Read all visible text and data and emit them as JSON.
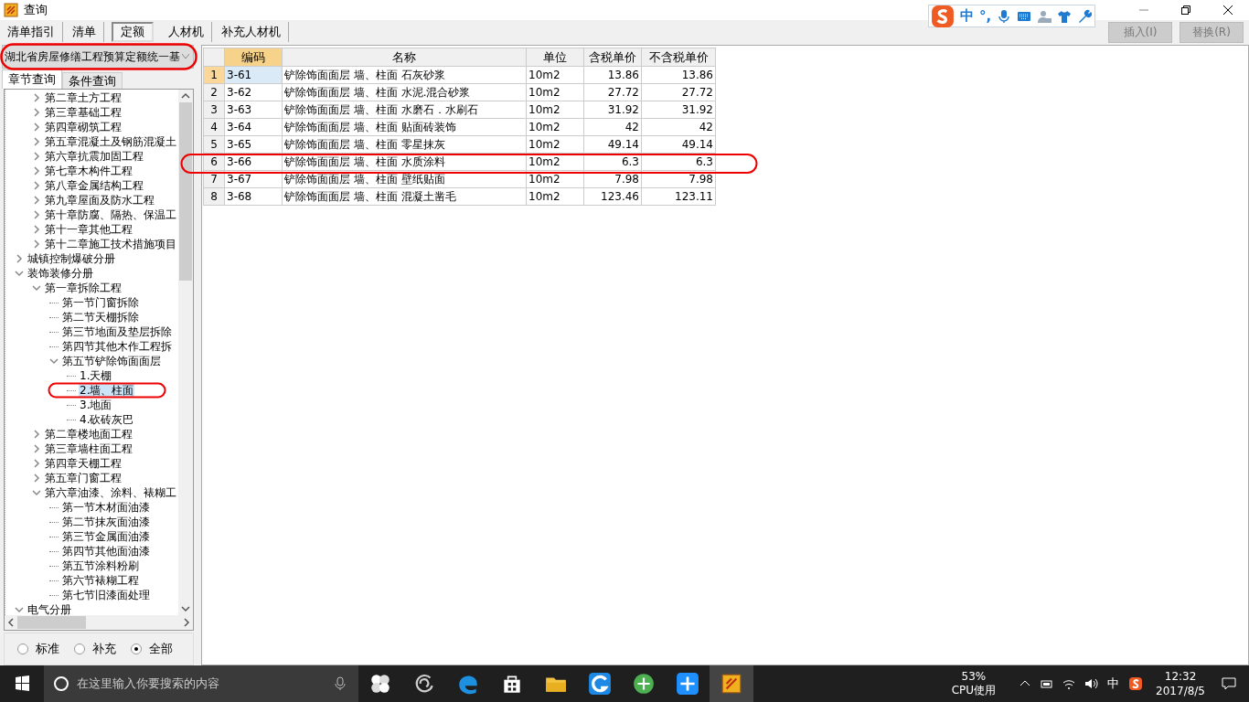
{
  "window": {
    "title": "查询"
  },
  "ime_bar": {
    "mode": "中",
    "punct": "°,"
  },
  "tabs": [
    {
      "label": "清单指引",
      "selected": false
    },
    {
      "label": "清单",
      "selected": false
    },
    {
      "label": "定额",
      "selected": true
    },
    {
      "label": "人材机",
      "selected": false
    },
    {
      "label": "补充人材机",
      "selected": false
    }
  ],
  "actions": [
    {
      "label": "插入(I)",
      "disabled": true
    },
    {
      "label": "替换(R)",
      "disabled": true
    }
  ],
  "quota_book": {
    "value": "湖北省房屋修缮工程预算定额统一基"
  },
  "search_tabs": [
    {
      "label": "章节查询",
      "selected": true
    },
    {
      "label": "条件查询",
      "selected": false
    }
  ],
  "tree": {
    "items": [
      {
        "children": [
          {
            "label": "第二章土方工程",
            "expanded": false,
            "selected": false
          },
          {
            "label": "第三章基础工程",
            "expanded": false,
            "selected": false
          },
          {
            "label": "第四章砌筑工程",
            "expanded": false,
            "selected": false
          },
          {
            "label": "第五章混凝土及钢筋混凝土",
            "expanded": false,
            "selected": false
          },
          {
            "label": "第六章抗震加固工程",
            "expanded": false,
            "selected": false
          },
          {
            "label": "第七章木构件工程",
            "expanded": false,
            "selected": false
          },
          {
            "label": "第八章金属结构工程",
            "expanded": false,
            "selected": false
          },
          {
            "label": "第九章屋面及防水工程",
            "expanded": false,
            "selected": false
          },
          {
            "label": "第十章防腐、隔热、保温工",
            "expanded": false,
            "selected": false
          },
          {
            "label": "第十一章其他工程",
            "expanded": false,
            "selected": false
          },
          {
            "label": "第十二章施工技术措施项目",
            "expanded": false,
            "selected": false
          }
        ]
      },
      {
        "label": "城镇控制爆破分册",
        "expanded": false,
        "selected": false
      },
      {
        "label": "装饰装修分册",
        "expanded": true,
        "selected": false,
        "children": [
          {
            "label": "第一章拆除工程",
            "expanded": true,
            "selected": false,
            "children": [
              {
                "label": "第一节门窗拆除",
                "selected": false
              },
              {
                "label": "第二节天棚拆除",
                "selected": false
              },
              {
                "label": "第三节地面及垫层拆除",
                "selected": false
              },
              {
                "label": "第四节其他木作工程拆",
                "selected": false
              },
              {
                "label": "第五节铲除饰面面层",
                "expanded": true,
                "selected": false,
                "children": [
                  {
                    "label": "1.天棚",
                    "selected": false
                  },
                  {
                    "label": "2.墙、柱面",
                    "selected": true
                  },
                  {
                    "label": "3.地面",
                    "selected": false
                  },
                  {
                    "label": "4.砍砖灰巴",
                    "selected": false
                  }
                ]
              }
            ]
          },
          {
            "label": "第二章楼地面工程",
            "expanded": false,
            "selected": false
          },
          {
            "label": "第三章墙柱面工程",
            "expanded": false,
            "selected": false
          },
          {
            "label": "第四章天棚工程",
            "expanded": false,
            "selected": false
          },
          {
            "label": "第五章门窗工程",
            "expanded": false,
            "selected": false
          },
          {
            "label": "第六章油漆、涂料、裱糊工",
            "expanded": true,
            "selected": false,
            "children": [
              {
                "label": "第一节木材面油漆",
                "selected": false
              },
              {
                "label": "第二节抹灰面油漆",
                "selected": false
              },
              {
                "label": "第三节金属面油漆",
                "selected": false
              },
              {
                "label": "第四节其他面油漆",
                "selected": false
              },
              {
                "label": "第五节涂料粉刷",
                "selected": false
              },
              {
                "label": "第六节裱糊工程",
                "selected": false
              },
              {
                "label": "第七节旧漆面处理",
                "selected": false
              }
            ]
          }
        ]
      },
      {
        "label": "电气分册",
        "expanded": true,
        "selected": false
      }
    ]
  },
  "filters": [
    {
      "label": "标准",
      "selected": false
    },
    {
      "label": "补充",
      "selected": false
    },
    {
      "label": "全部",
      "selected": true
    }
  ],
  "table": {
    "columns": [
      "编码",
      "名称",
      "单位",
      "含税单价",
      "不含税单价"
    ],
    "rows": [
      {
        "num": "1",
        "code": "3-61",
        "name": "铲除饰面面层 墙、柱面 石灰砂浆",
        "unit": "10m2",
        "tax": "13.86",
        "notax": "13.86",
        "selected": true
      },
      {
        "num": "2",
        "code": "3-62",
        "name": "铲除饰面面层 墙、柱面 水泥.混合砂浆",
        "unit": "10m2",
        "tax": "27.72",
        "notax": "27.72",
        "selected": false
      },
      {
        "num": "3",
        "code": "3-63",
        "name": "铲除饰面面层 墙、柱面 水磨石．水刷石",
        "unit": "10m2",
        "tax": "31.92",
        "notax": "31.92",
        "selected": false
      },
      {
        "num": "4",
        "code": "3-64",
        "name": "铲除饰面面层 墙、柱面 贴面砖装饰",
        "unit": "10m2",
        "tax": "42",
        "notax": "42",
        "selected": false
      },
      {
        "num": "5",
        "code": "3-65",
        "name": "铲除饰面面层 墙、柱面 零星抹灰",
        "unit": "10m2",
        "tax": "49.14",
        "notax": "49.14",
        "selected": false
      },
      {
        "num": "6",
        "code": "3-66",
        "name": "铲除饰面面层 墙、柱面 水质涂料",
        "unit": "10m2",
        "tax": "6.3",
        "notax": "6.3",
        "selected": false
      },
      {
        "num": "7",
        "code": "3-67",
        "name": "铲除饰面面层 墙、柱面 壁纸贴面",
        "unit": "10m2",
        "tax": "7.98",
        "notax": "7.98",
        "selected": false
      },
      {
        "num": "8",
        "code": "3-68",
        "name": "铲除饰面面层 墙、柱面 混凝土凿毛",
        "unit": "10m2",
        "tax": "123.46",
        "notax": "123.11",
        "selected": false
      }
    ]
  },
  "taskbar": {
    "search_placeholder": "在这里输入你要搜索的内容",
    "cpu": "53%",
    "cpu_label": "CPU使用",
    "ime": "中",
    "time": "12:32",
    "date": "2017/8/5"
  }
}
